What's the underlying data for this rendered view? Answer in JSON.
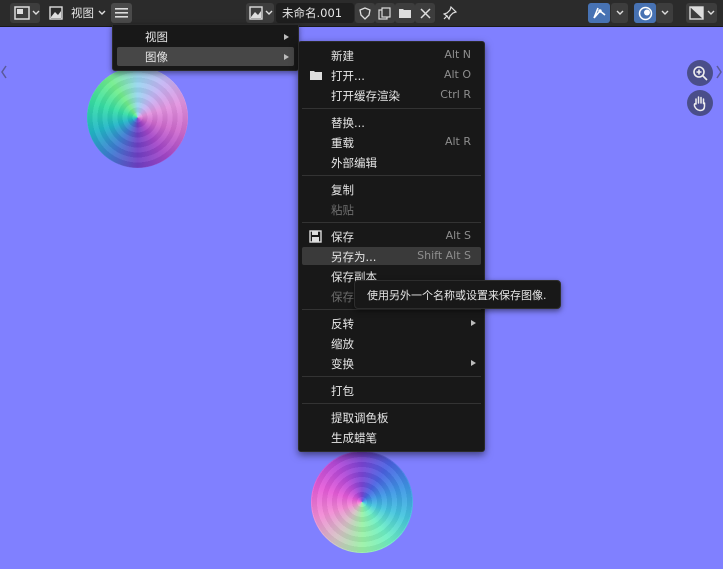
{
  "header": {
    "editor_type_icon": "image-editor-icon",
    "view_menu": "视图",
    "image_name": "未命名.001",
    "icons": [
      "fake-user-shield-icon",
      "duplicate-icon",
      "folder-icon",
      "close-icon",
      "pin-icon",
      "gizmo-icon",
      "overlay-icon",
      "display-channels-icon"
    ]
  },
  "submenu": {
    "items": [
      {
        "label": "视图"
      },
      {
        "label": "图像"
      }
    ]
  },
  "image_menu": {
    "new": {
      "label": "新建",
      "shortcut": "Alt N"
    },
    "open": {
      "label": "打开...",
      "shortcut": "Alt O"
    },
    "open_cached": {
      "label": "打开缓存渲染",
      "shortcut": "Ctrl R"
    },
    "replace": {
      "label": "替换..."
    },
    "reload": {
      "label": "重载",
      "shortcut": "Alt R"
    },
    "external_edit": {
      "label": "外部编辑"
    },
    "copy": {
      "label": "复制"
    },
    "paste": {
      "label": "粘贴"
    },
    "save": {
      "label": "保存",
      "shortcut": "Alt S"
    },
    "save_as": {
      "label": "另存为...",
      "shortcut": "Shift Alt S"
    },
    "save_copy": {
      "label": "保存副本"
    },
    "save_all": {
      "label": "保存"
    },
    "invert": {
      "label": "反转"
    },
    "resize": {
      "label": "缩放"
    },
    "transform": {
      "label": "变换"
    },
    "pack": {
      "label": "打包"
    },
    "extract_palette": {
      "label": "提取调色板"
    },
    "generate_grease_pencil": {
      "label": "生成蜡笔"
    }
  },
  "tooltip": {
    "text": "使用另外一个名称或设置来保存图像."
  },
  "colors": {
    "viewport_bg": "#8080ff",
    "menu_bg": "#181818",
    "highlight": "#3a3a3a"
  }
}
